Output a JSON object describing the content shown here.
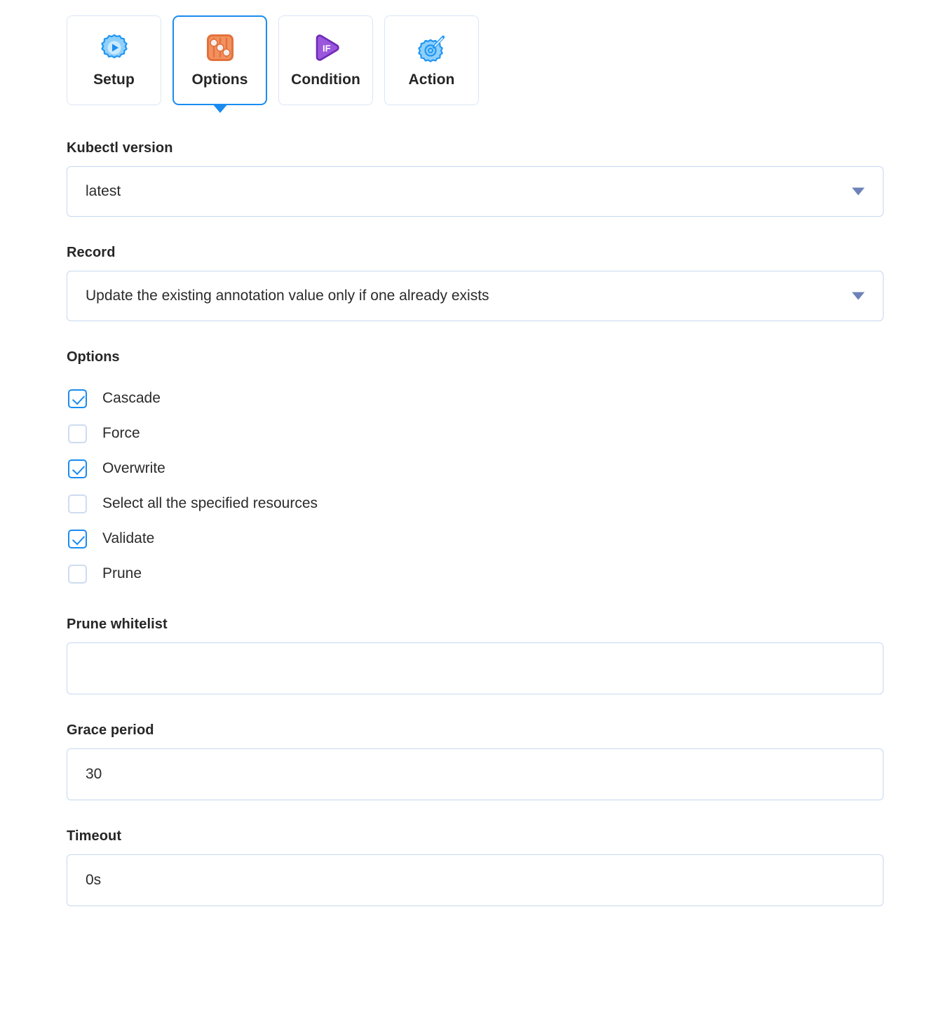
{
  "tabs": [
    {
      "label": "Setup",
      "icon": "gear-play-icon",
      "active": false
    },
    {
      "label": "Options",
      "icon": "sliders-icon",
      "active": true
    },
    {
      "label": "Condition",
      "icon": "if-play-icon",
      "active": false
    },
    {
      "label": "Action",
      "icon": "gear-wand-icon",
      "active": false
    }
  ],
  "form": {
    "kubectl_version": {
      "label": "Kubectl version",
      "value": "latest",
      "caret": "chevron-down-icon"
    },
    "record": {
      "label": "Record",
      "value": "Update the existing annotation value only if one already exists",
      "caret": "chevron-down-icon"
    },
    "options": {
      "label": "Options",
      "items": [
        {
          "label": "Cascade",
          "checked": true
        },
        {
          "label": "Force",
          "checked": false
        },
        {
          "label": "Overwrite",
          "checked": true
        },
        {
          "label": "Select all the specified resources",
          "checked": false
        },
        {
          "label": "Validate",
          "checked": true
        },
        {
          "label": "Prune",
          "checked": false
        }
      ]
    },
    "prune_whitelist": {
      "label": "Prune whitelist",
      "value": "",
      "placeholder": ""
    },
    "grace_period": {
      "label": "Grace period",
      "value": "30",
      "placeholder": ""
    },
    "timeout": {
      "label": "Timeout",
      "value": "0s",
      "placeholder": ""
    }
  },
  "colors": {
    "accent": "#1a8cf0",
    "border": "#c6d8f0",
    "tab_border": "#dce6f5",
    "caret": "#6d82b8",
    "text": "#2b2b2b",
    "options_icon": "#f0804f",
    "condition_icon": "#8b3fd4"
  }
}
